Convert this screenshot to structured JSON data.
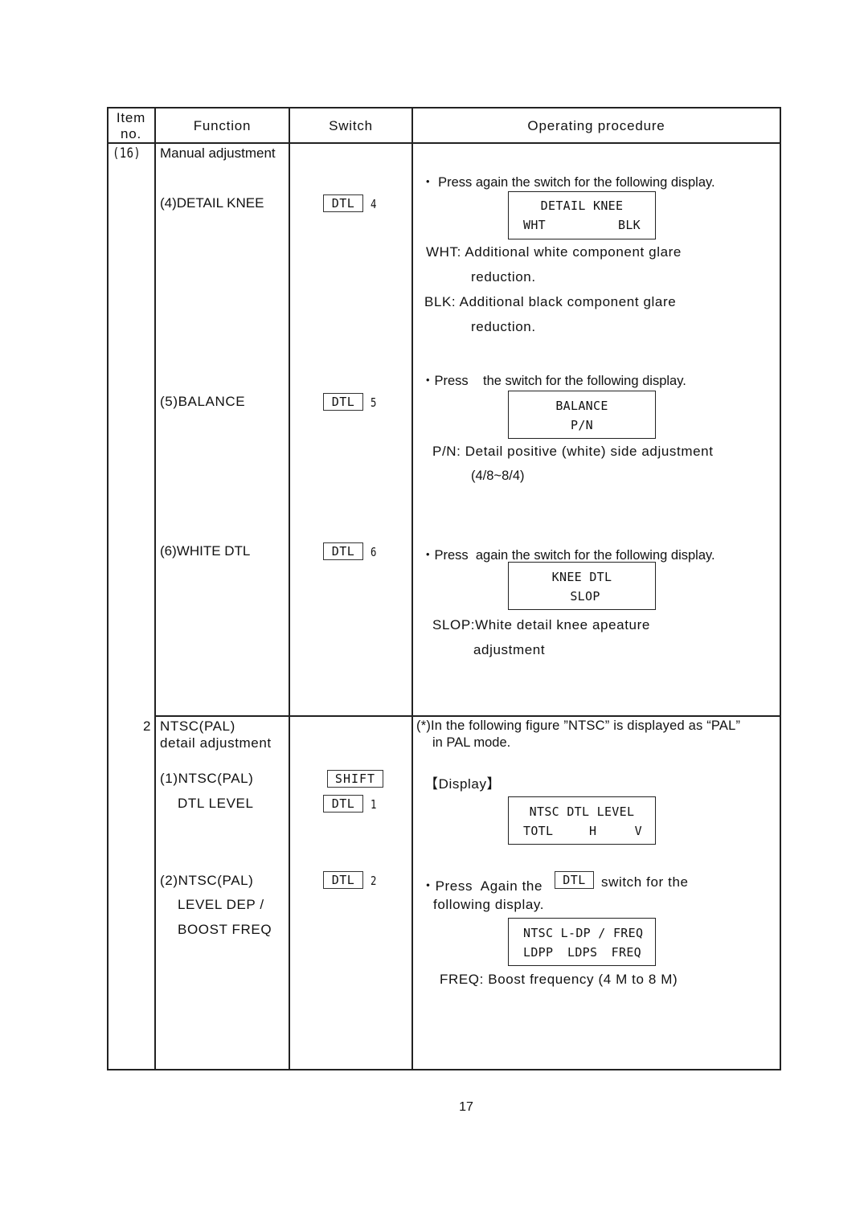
{
  "table": {
    "headers": {
      "item_no_line1": "Item",
      "item_no_line2": "no.",
      "function": "Function",
      "switch": "Switch",
      "procedure": "Operating procedure"
    },
    "section16": {
      "item_no": "(16)",
      "function_title": "Manual adjustment",
      "entries": [
        {
          "function": "(4)DETAIL KNEE",
          "switch_key": "DTL",
          "switch_num": "4",
          "instruction": "・  Press again the switch for the following display.",
          "display_line1": "DETAIL KNEE",
          "display_line2_left": "WHT",
          "display_line2_right": "BLK",
          "notes": [
            "WHT: Additional white component glare",
            "reduction.",
            "BLK: Additional black component glare",
            "reduction."
          ]
        },
        {
          "function": "(5)BALANCE",
          "switch_key": "DTL",
          "switch_num": "5",
          "instruction": "・Press    the switch for the following display.",
          "display_line1": "BALANCE",
          "display_line2": "P/N",
          "notes": [
            "P/N: Detail positive (white) side adjustment",
            "(4/8~8/4)"
          ]
        },
        {
          "function": "(6)WHITE DTL",
          "switch_key": "DTL",
          "switch_num": "6",
          "instruction": "・Press  again the switch for the following display.",
          "display_line1": "KNEE DTL",
          "display_line2": "SLOP",
          "notes": [
            "SLOP:White detail knee apeature",
            "adjustment"
          ]
        }
      ]
    },
    "section2": {
      "item_no": "2",
      "function_title_line1": "NTSC(PAL)",
      "function_title_line2": "detail adjustment",
      "note_line1": "(*)In the following figure ”NTSC” is displayed as “PAL”",
      "note_line2": "in PAL mode.",
      "display_label": "【Display】",
      "entries": [
        {
          "function_line1": "(1)NTSC(PAL)",
          "function_line2": "DTL LEVEL",
          "switch_key_shift": "SHIFT",
          "switch_key": "DTL",
          "switch_num": "1",
          "display_line1": "NTSC DTL LEVEL",
          "display_line2_a": "TOTL",
          "display_line2_b": "H",
          "display_line2_c": "V"
        },
        {
          "function_line1": "(2)NTSC(PAL)",
          "function_line2": "LEVEL DEP /",
          "function_line3": "BOOST FREQ",
          "switch_key": "DTL",
          "switch_num": "2",
          "instruction_pre": "・Press  Again the",
          "instruction_key": "DTL",
          "instruction_post": "switch for the",
          "instruction_line2": "following display.",
          "display_line1": "NTSC L-DP / FREQ",
          "display_line2_a": "LDPP",
          "display_line2_b": "LDPS",
          "display_line2_c": "FREQ",
          "note": "FREQ: Boost frequency (4 M to 8 M)"
        }
      ]
    }
  },
  "page_number": "17"
}
